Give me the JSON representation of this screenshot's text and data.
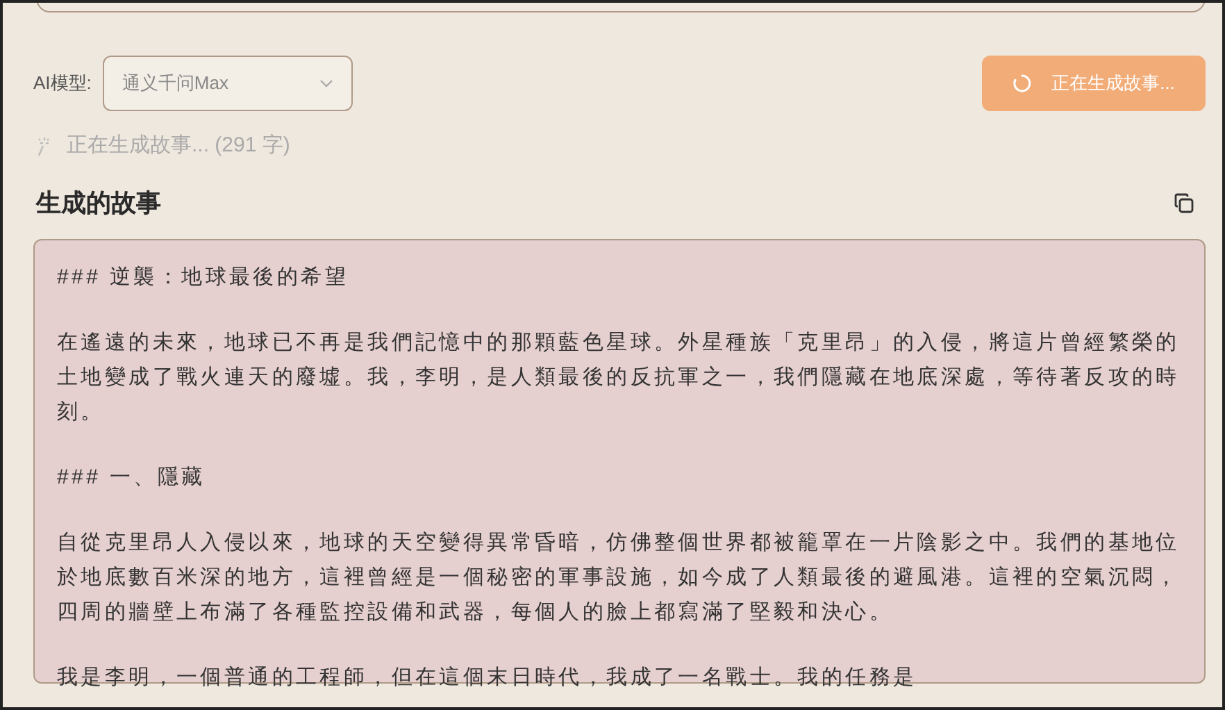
{
  "model_select": {
    "label": "AI模型:",
    "value": "通义千问Max"
  },
  "generate_button": {
    "label": "正在生成故事...",
    "loading": true
  },
  "status": "正在生成故事... (291 字)",
  "story": {
    "title": "生成的故事",
    "paragraphs": [
      "### 逆襲：地球最後的希望",
      "在遙遠的未來，地球已不再是我們記憶中的那顆藍色星球。外星種族「克里昂」的入侵，將這片曾經繁榮的土地變成了戰火連天的廢墟。我，李明，是人類最後的反抗軍之一，我們隱藏在地底深處，等待著反攻的時刻。",
      "### 一、隱藏",
      "自從克里昂人入侵以來，地球的天空變得異常昏暗，仿佛整個世界都被籠罩在一片陰影之中。我們的基地位於地底數百米深的地方，這裡曾經是一個秘密的軍事設施，如今成了人類最後的避風港。這裡的空氣沉悶，四周的牆壁上布滿了各種監控設備和武器，每個人的臉上都寫滿了堅毅和決心。",
      "我是李明，一個普通的工程師，但在這個末日時代，我成了一名戰士。我的任務是"
    ]
  }
}
